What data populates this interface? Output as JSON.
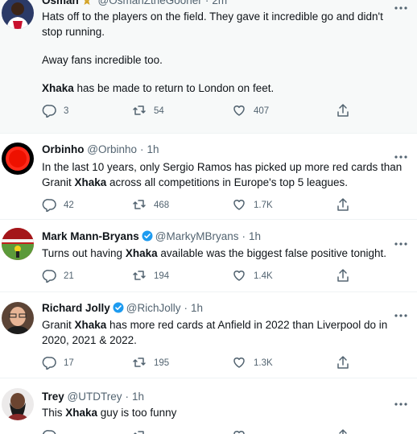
{
  "tweets": [
    {
      "name": "Osman",
      "badge": "ribbon",
      "handle": "@OsmanZtheGooner",
      "time": "2m",
      "paragraphs": [
        [
          {
            "t": "Hats off to the players on the field. They gave it incredible go and didn't stop running."
          }
        ],
        [
          {
            "t": "Away fans incredible too."
          }
        ],
        [
          {
            "t": "Xhaka",
            "b": true
          },
          {
            "t": " has be made to return to London on feet."
          }
        ]
      ],
      "replies": "3",
      "retweets": "54",
      "likes": "407"
    },
    {
      "name": "Orbinho",
      "handle": "@Orbinho",
      "time": "1h",
      "paragraphs": [
        [
          {
            "t": "In the last 10 years, only Sergio Ramos has picked up more red cards than Granit "
          },
          {
            "t": "Xhaka",
            "b": true
          },
          {
            "t": " across all competitions in Europe's top 5 leagues."
          }
        ]
      ],
      "replies": "42",
      "retweets": "468",
      "likes": "1.7K"
    },
    {
      "name": "Mark Mann-Bryans",
      "verified": true,
      "handle": "@MarkyMBryans",
      "time": "1h",
      "paragraphs": [
        [
          {
            "t": "Turns out having "
          },
          {
            "t": "Xhaka",
            "b": true
          },
          {
            "t": " available was the biggest false positive tonight."
          }
        ]
      ],
      "replies": "21",
      "retweets": "194",
      "likes": "1.4K"
    },
    {
      "name": "Richard Jolly",
      "verified": true,
      "handle": "@RichJolly",
      "time": "1h",
      "paragraphs": [
        [
          {
            "t": "Granit "
          },
          {
            "t": "Xhaka",
            "b": true
          },
          {
            "t": " has more red cards at Anfield in 2022 than Liverpool do in 2020, 2021 & 2022."
          }
        ]
      ],
      "replies": "17",
      "retweets": "195",
      "likes": "1.3K"
    },
    {
      "name": "Trey",
      "handle": "@UTDTrey",
      "time": "1h",
      "paragraphs": [
        [
          {
            "t": "This "
          },
          {
            "t": "Xhaka",
            "b": true
          },
          {
            "t": " guy is too funny"
          }
        ]
      ],
      "replies": "",
      "retweets": "",
      "likes": ""
    }
  ],
  "separator": "·",
  "colors": {
    "verified": "#1d9bf0",
    "text": "#0f1419",
    "muted": "#536471",
    "ribbon": "#d4a52a"
  }
}
